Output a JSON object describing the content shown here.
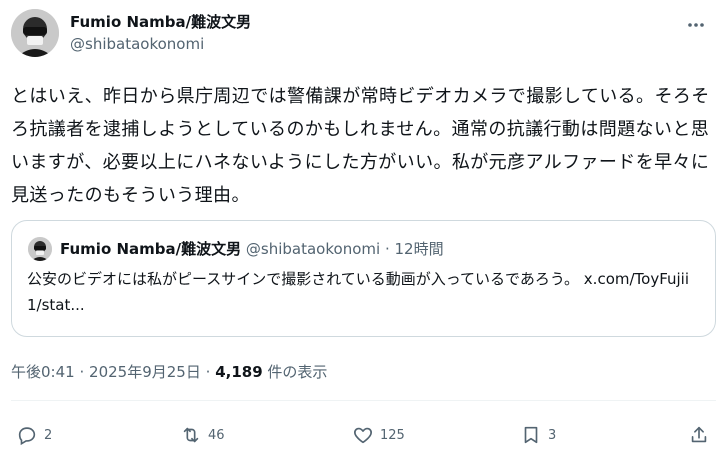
{
  "author": {
    "name": "Fumio Namba/難波文男",
    "handle": "@shibataokonomi"
  },
  "tweet_text": "とはいえ、昨日から県庁周辺では警備課が常時ビデオカメラで撮影している。そろそろ抗議者を逮捕しようとしているのかもしれません。通常の抗議行動は問題ないと思いますが、必要以上にハネないようにした方がいい。私が元彦アルファードを早々に見送ったのもそういう理由。",
  "quote": {
    "name": "Fumio Namba/難波文男",
    "handle": "@shibataokonomi",
    "separator": "·",
    "time": "12時間",
    "text": "公安のビデオには私がピースサインで撮影されている動画が入っているであろう。",
    "link": "x.com/ToyFujii1/stat..."
  },
  "meta": {
    "time": "午後0:41",
    "separator": "·",
    "date": "2025年9月25日",
    "separator2": "·",
    "views_count": "4,189",
    "views_label": "件の表示"
  },
  "actions": {
    "reply_count": "2",
    "retweet_count": "46",
    "like_count": "125",
    "bookmark_count": "3"
  },
  "icons": {
    "more": "more-icon",
    "reply": "reply-icon",
    "retweet": "retweet-icon",
    "like": "heart-icon",
    "bookmark": "bookmark-icon",
    "share": "share-icon"
  },
  "colors": {
    "text": "#0f1419",
    "muted": "#536471",
    "border": "#cfd9de"
  }
}
